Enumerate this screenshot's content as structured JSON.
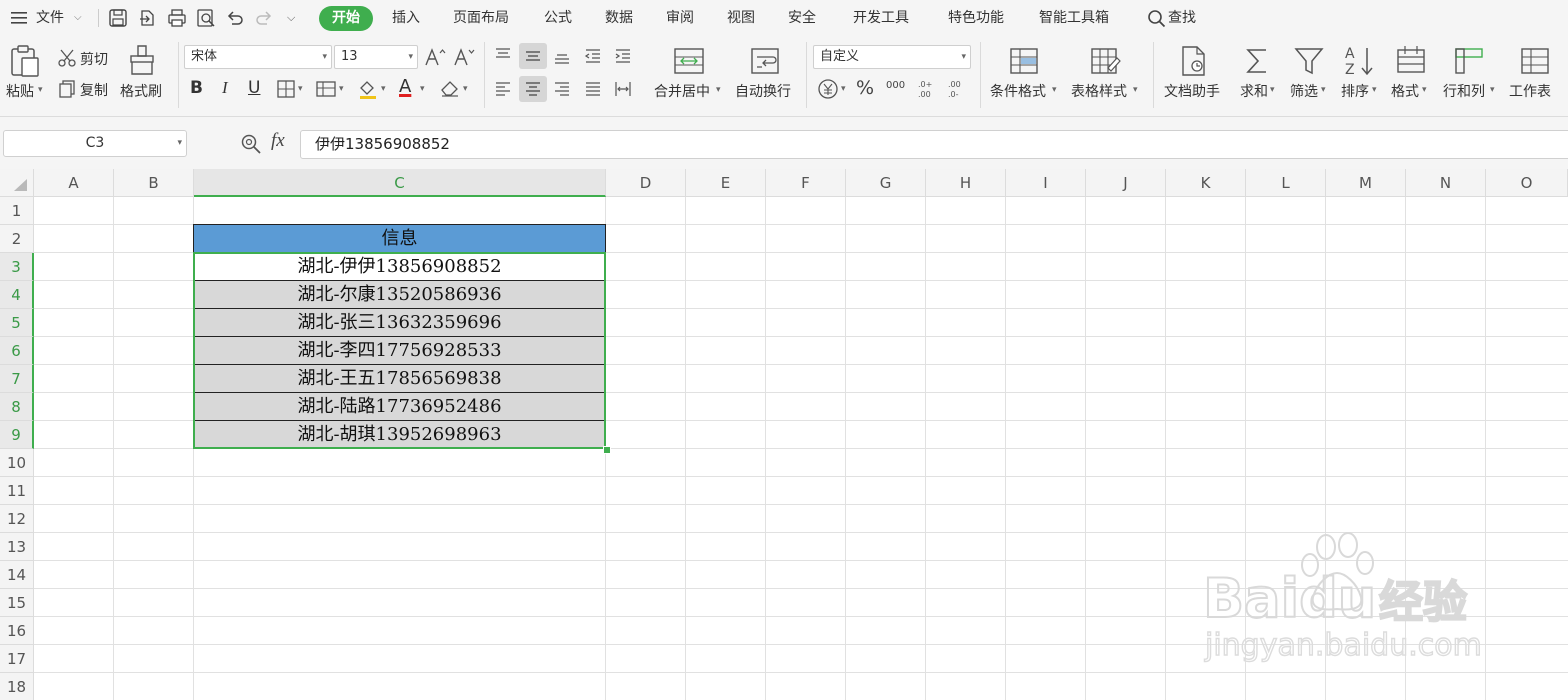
{
  "menu": {
    "file_label": "文件",
    "tabs": [
      {
        "label": "开始",
        "active": true
      },
      {
        "label": "插入"
      },
      {
        "label": "页面布局"
      },
      {
        "label": "公式"
      },
      {
        "label": "数据"
      },
      {
        "label": "审阅"
      },
      {
        "label": "视图"
      },
      {
        "label": "安全"
      },
      {
        "label": "开发工具"
      },
      {
        "label": "特色功能"
      },
      {
        "label": "智能工具箱"
      }
    ],
    "search_label": "查找",
    "accent_color": "#3fae4e"
  },
  "ribbon": {
    "paste": "粘贴",
    "cut": "剪切",
    "copy": "复制",
    "format_painter": "格式刷",
    "font_name": "宋体",
    "font_size": "13",
    "bold": "B",
    "italic": "I",
    "underline": "U",
    "font_color_letter": "A",
    "merge_center": "合并居中",
    "wrap_text": "自动换行",
    "number_format": "自定义",
    "percent": "%",
    "thousands": "000",
    "conditional_format": "条件格式",
    "table_style": "表格样式",
    "doc_assistant": "文档助手",
    "sum": "求和",
    "filter": "筛选",
    "sort": "排序",
    "format": "格式",
    "row_col": "行和列",
    "worksheet": "工作表"
  },
  "formula_bar": {
    "cell_ref": "C3",
    "fx_label": "fx",
    "content": "伊伊13856908852"
  },
  "sheet": {
    "columns": [
      "A",
      "B",
      "C",
      "D",
      "E",
      "F",
      "G",
      "H",
      "I",
      "J",
      "K",
      "L",
      "M",
      "N",
      "O"
    ],
    "selected_column": "C",
    "rows": [
      "1",
      "2",
      "3",
      "4",
      "5",
      "6",
      "7",
      "8",
      "9",
      "10",
      "11",
      "12",
      "13",
      "14",
      "15",
      "16",
      "17",
      "18"
    ],
    "selected_rows": [
      "3",
      "4",
      "5",
      "6",
      "7",
      "8",
      "9"
    ],
    "table_header": "信息",
    "header_color": "#5b9bd5",
    "row_fill_color": "#d8d8d8",
    "entries": [
      "湖北-伊伊13856908852",
      "湖北-尔康13520586936",
      "湖北-张三13632359696",
      "湖北-李四17756928533",
      "湖北-王五17856569838",
      "湖北-陆路17736952486",
      "湖北-胡琪13952698963"
    ]
  },
  "watermark": {
    "brand": "Baidu",
    "suffix": "经验",
    "url": "jingyan.baidu.com"
  }
}
